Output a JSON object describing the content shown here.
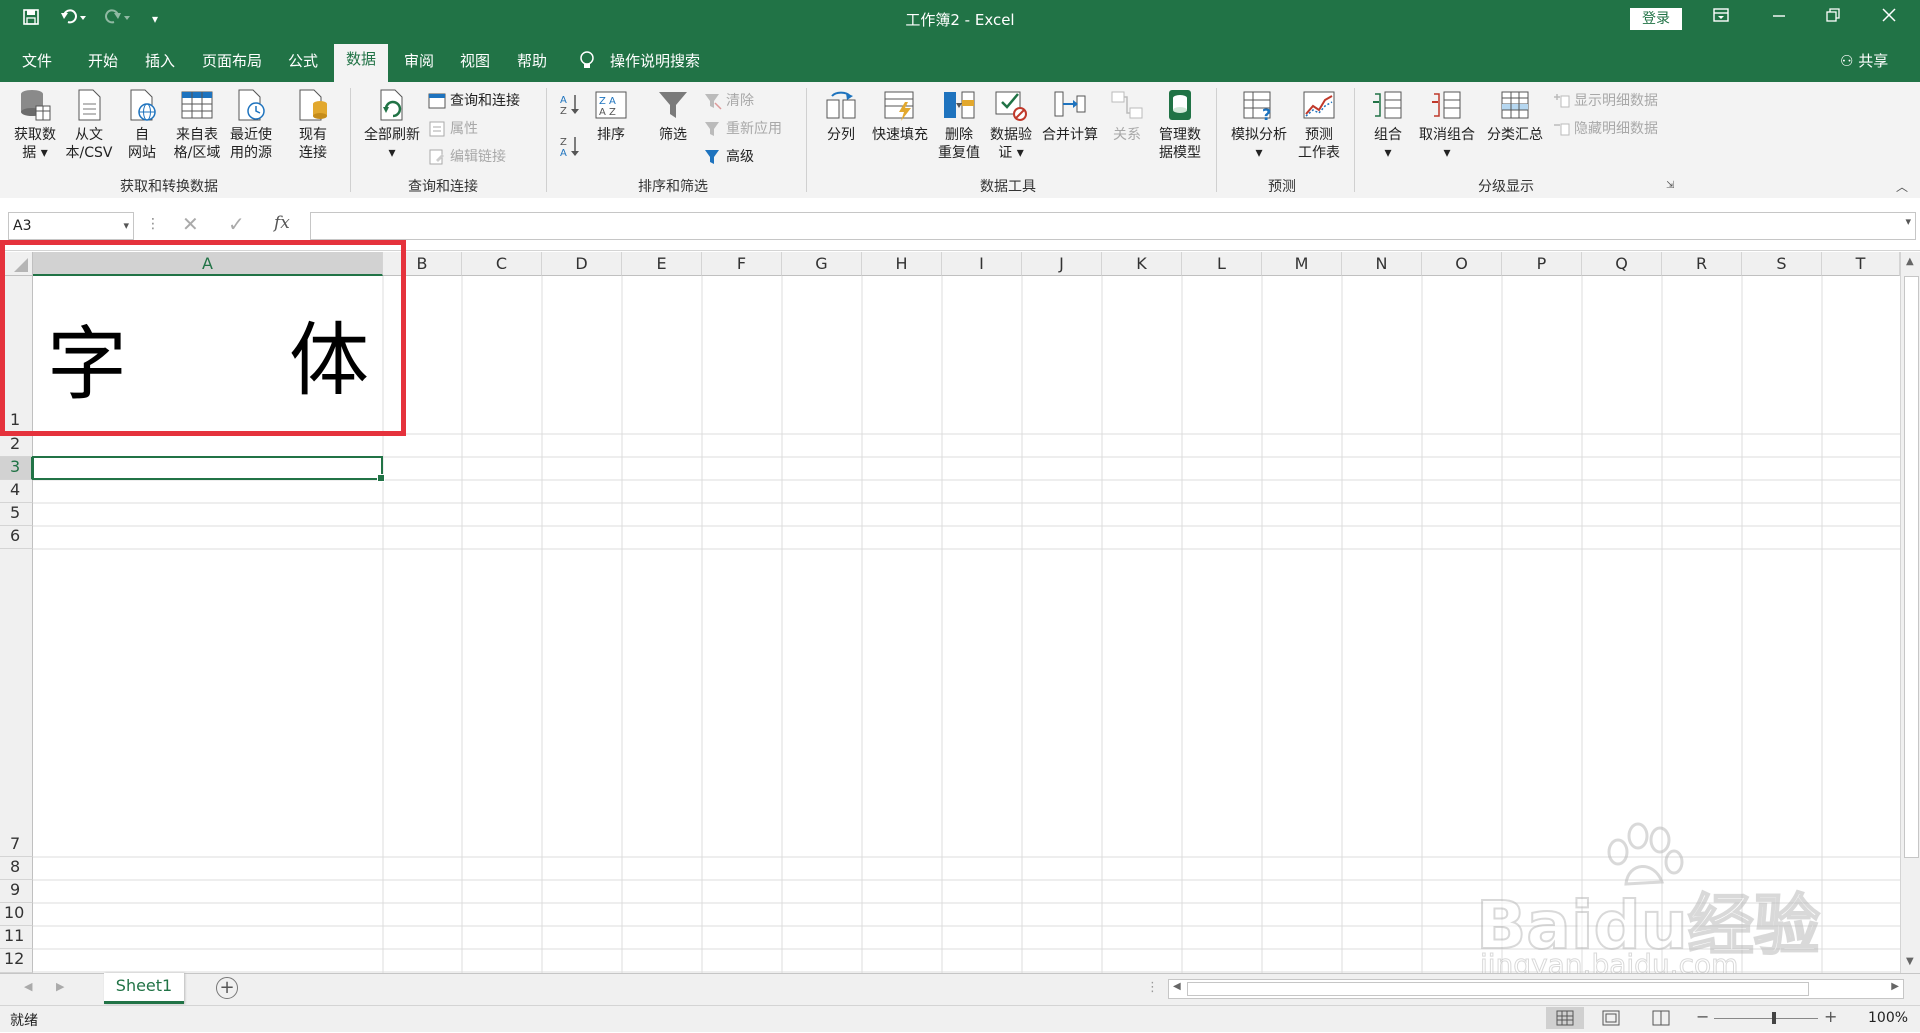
{
  "window": {
    "title": "工作簿2  -  Excel",
    "login": "登录"
  },
  "menu": {
    "tabs": [
      "文件",
      "开始",
      "插入",
      "页面布局",
      "公式",
      "数据",
      "审阅",
      "视图",
      "帮助"
    ],
    "active": "数据",
    "search": "操作说明搜索",
    "share": "共享"
  },
  "ribbon": {
    "get_data": [
      "获取数",
      "据 ▾"
    ],
    "from_csv": [
      "从文",
      "本/CSV"
    ],
    "from_web": [
      "自",
      "网站"
    ],
    "from_table": [
      "来自表",
      "格/区域"
    ],
    "recent_sources": [
      "最近使",
      "用的源"
    ],
    "existing_conn": [
      "现有",
      "连接"
    ],
    "group_get_transform": "获取和转换数据",
    "refresh_all": "全部刷新",
    "queries_connections": "查询和连接",
    "properties": "属性",
    "edit_links": "编辑链接",
    "group_queries": "查询和连接",
    "sort": "排序",
    "filter": "筛选",
    "clear": "清除",
    "reapply": "重新应用",
    "advanced": "高级",
    "group_sort_filter": "排序和筛选",
    "text_to_columns": "分列",
    "flash_fill": "快速填充",
    "remove_dup": [
      "删除",
      "重复值"
    ],
    "data_validation": [
      "数据验",
      "证 ▾"
    ],
    "consolidate": "合并计算",
    "relationships": "关系",
    "manage_model": [
      "管理数",
      "据模型"
    ],
    "group_data_tools": "数据工具",
    "what_if": "模拟分析",
    "forecast_sheet": [
      "预测",
      "工作表"
    ],
    "group_forecast": "预测",
    "group_cmd": "组合",
    "ungroup": "取消组合",
    "subtotal": "分类汇总",
    "show_detail": "显示明细数据",
    "hide_detail": "隐藏明细数据",
    "group_outline": "分级显示"
  },
  "formula": {
    "namebox": "A3",
    "fx": "fx",
    "value": ""
  },
  "columns": [
    "A",
    "B",
    "C",
    "D",
    "E",
    "F",
    "G",
    "H",
    "I",
    "J",
    "K",
    "L",
    "M",
    "N",
    "O",
    "P",
    "Q",
    "R",
    "S",
    "T"
  ],
  "rows": [
    "1",
    "2",
    "3",
    "4",
    "5",
    "6",
    "7",
    "8",
    "9",
    "10",
    "11",
    "12"
  ],
  "cells": {
    "A1_left": "字",
    "A1_right": "体"
  },
  "sheet": {
    "tab": "Sheet1"
  },
  "status": {
    "ready": "就绪",
    "zoom": "100%"
  },
  "colors": {
    "excel_green": "#217346",
    "highlight_red": "#e5323c"
  },
  "watermark": {
    "brand": "Baidu经验",
    "url": "jingyan.baidu.com"
  }
}
